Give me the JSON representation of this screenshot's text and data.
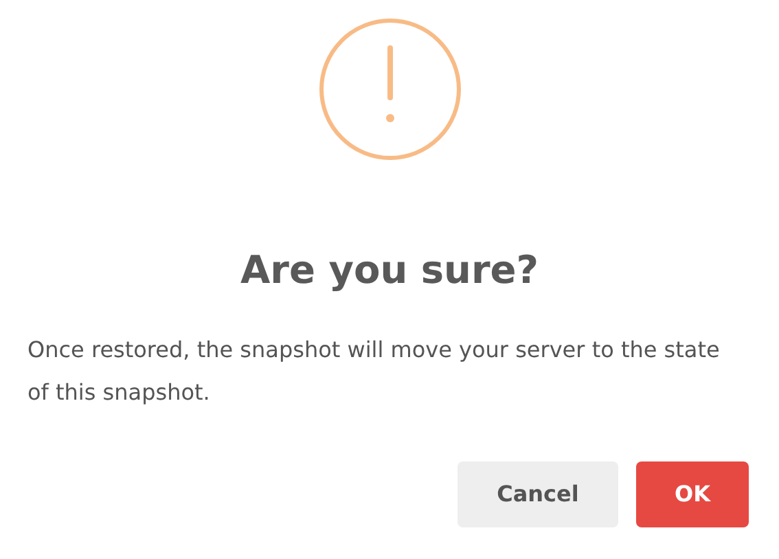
{
  "dialog": {
    "title": "Are you sure?",
    "message": "Once restored, the snapshot will move your server to the state of this snapshot.",
    "buttons": [
      {
        "label": "Cancel",
        "kind": "secondary"
      },
      {
        "label": "OK",
        "kind": "primary"
      }
    ]
  }
}
